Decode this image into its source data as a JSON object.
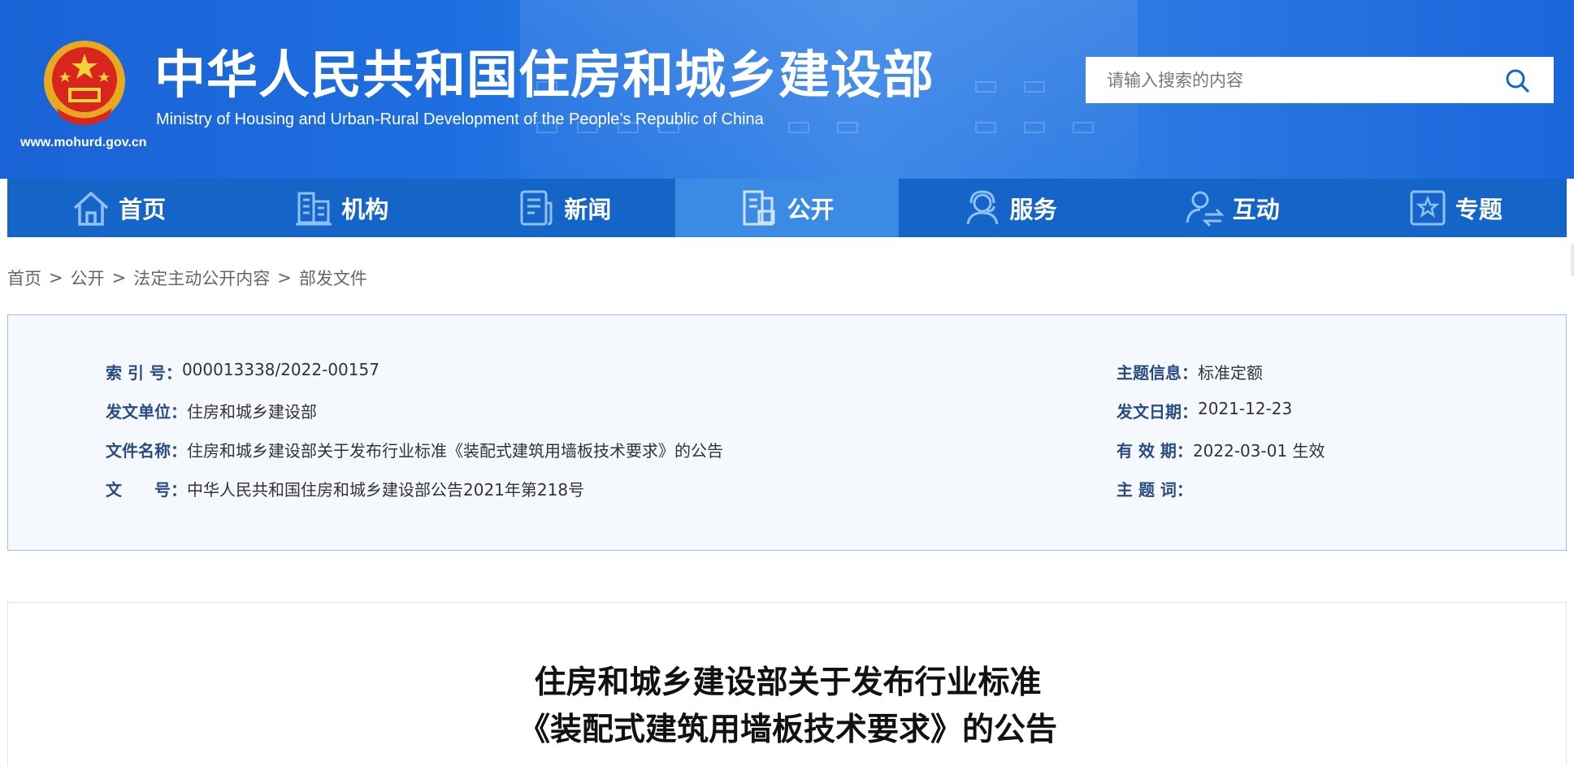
{
  "header": {
    "title_cn": "中华人民共和国住房和城乡建设部",
    "title_en": "Ministry of Housing and Urban-Rural Development of the People’s Republic of China",
    "url": "www.mohurd.gov.cn",
    "emblem_icon": "national-emblem-icon",
    "brand_color": "#1565c9"
  },
  "search": {
    "placeholder": "请输入搜索的内容",
    "value": "",
    "icon": "search-icon"
  },
  "nav": {
    "items": [
      {
        "label": "首页",
        "icon": "home-icon",
        "active": false
      },
      {
        "label": "机构",
        "icon": "building-icon",
        "active": false
      },
      {
        "label": "新闻",
        "icon": "news-icon",
        "active": false
      },
      {
        "label": "公开",
        "icon": "document-icon",
        "active": true
      },
      {
        "label": "服务",
        "icon": "service-agent-icon",
        "active": false
      },
      {
        "label": "互动",
        "icon": "interaction-icon",
        "active": false
      },
      {
        "label": "专题",
        "icon": "star-topic-icon",
        "active": false
      }
    ],
    "active_color": "#3b8be4"
  },
  "breadcrumb": {
    "items": [
      "首页",
      "公开",
      "法定主动公开内容",
      "部发文件"
    ],
    "separator": ">"
  },
  "info": {
    "left": [
      {
        "label": "索 引 号：",
        "value": "000013338/2022-00157"
      },
      {
        "label": "发文单位：",
        "value": "住房和城乡建设部"
      },
      {
        "label": "文件名称：",
        "value": "住房和城乡建设部关于发布行业标准《装配式建筑用墙板技术要求》的公告"
      },
      {
        "label": "文　　号：",
        "value": "中华人民共和国住房和城乡建设部公告2021年第218号"
      }
    ],
    "right": [
      {
        "label": "主题信息：",
        "value": "标准定额"
      },
      {
        "label": "发文日期：",
        "value": "2021-12-23"
      },
      {
        "label": "有 效 期：",
        "value": "2022-03-01 生效"
      },
      {
        "label": "主 题 词：",
        "value": ""
      }
    ]
  },
  "article": {
    "title_line1": "住房和城乡建设部关于发布行业标准",
    "title_line2": "《装配式建筑用墙板技术要求》的公告"
  }
}
